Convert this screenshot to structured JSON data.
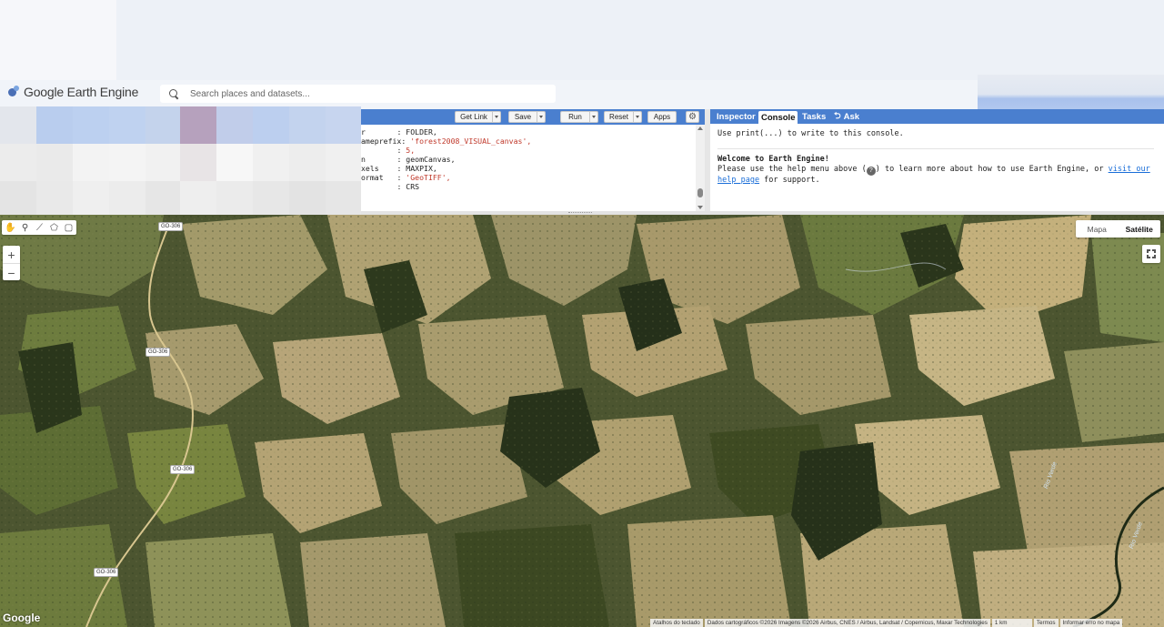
{
  "app": {
    "name": "Google Earth Engine"
  },
  "search": {
    "placeholder": "Search places and datasets..."
  },
  "editor": {
    "buttons": {
      "get_link": "Get Link",
      "save": "Save",
      "run": "Run",
      "reset": "Reset",
      "apps": "Apps"
    },
    "code_lines": [
      {
        "key": "r       ",
        "sep": ": ",
        "value": "FOLDER,",
        "is_string": false
      },
      {
        "key": "ameprefix",
        "sep": ": ",
        "value": "'forest2008_VISUAL_canvas',",
        "is_string": true
      },
      {
        "key": "        ",
        "sep": ": ",
        "value": "5,",
        "is_string": false
      },
      {
        "key": "n       ",
        "sep": ": ",
        "value": "geomCanvas,",
        "is_string": false
      },
      {
        "key": "xels    ",
        "sep": ": ",
        "value": "MAXPIX,",
        "is_string": false
      },
      {
        "key": "ormat   ",
        "sep": ": ",
        "value": "'GeoTIFF',",
        "is_string": true
      },
      {
        "key": "        ",
        "sep": ": ",
        "value": "CRS",
        "is_string": false
      }
    ]
  },
  "right_panel": {
    "tabs": {
      "inspector": "Inspector",
      "console": "Console",
      "tasks": "Tasks",
      "ask": "Ask"
    },
    "console": {
      "print_hint": "Use print(...) to write to this console.",
      "welcome_title": "Welcome to Earth Engine!",
      "help_text_before": "Please use the help menu above (",
      "help_text_after": ") to learn more about how to use Earth Engine, or ",
      "help_link": "visit our help page",
      "help_text_end": " for support."
    }
  },
  "map": {
    "map_type": {
      "map": "Mapa",
      "satellite": "Satélite",
      "selected": "Satélite"
    },
    "zoom_in": "+",
    "zoom_out": "−",
    "google_logo": "Google",
    "road_labels": [
      "GO-306",
      "GO-306",
      "GO-306",
      "GO-306"
    ],
    "river_labels": [
      "Rio Verde",
      "Rio Verde"
    ],
    "attribution": {
      "shortcuts": "Atalhos do teclado",
      "data": "Dados cartográficos ©2026 Imagens ©2026 Airbus, CNES / Airbus, Landsat / Copernicus, Maxar Technologies",
      "scale": "1 km",
      "terms": "Termos",
      "report": "Informar erro no mapa"
    }
  },
  "colors": {
    "panel_blue": "#4a7fcf",
    "string_red": "#c0392b",
    "link_blue": "#1a6ed8"
  }
}
